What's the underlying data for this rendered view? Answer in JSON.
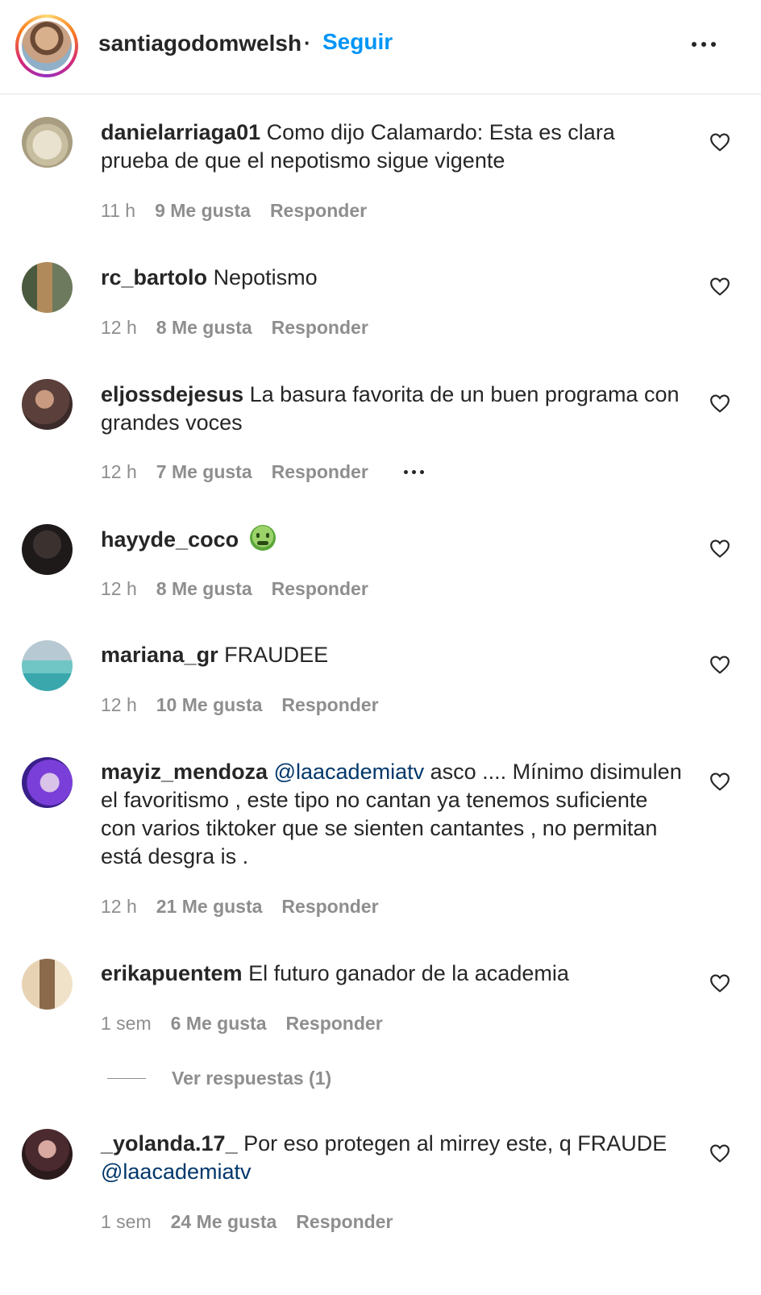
{
  "header": {
    "username": "santiagodomwelsh",
    "separator": "·",
    "follow_label": "Seguir"
  },
  "comments": [
    {
      "user": "danielarriaga01",
      "text": "Como dijo Calamardo: Esta es clara prueba de que el nepotismo sigue vigente",
      "time": "11 h",
      "likes": "9 Me gusta",
      "reply": "Responder"
    },
    {
      "user": "rc_bartolo",
      "text": "Nepotismo",
      "time": "12 h",
      "likes": "8 Me gusta",
      "reply": "Responder"
    },
    {
      "user": "eljossdejesus",
      "text": "La basura favorita de un buen programa con grandes voces",
      "time": "12 h",
      "likes": "7 Me gusta",
      "reply": "Responder"
    },
    {
      "user": "hayyde_coco",
      "text": "",
      "emoji": "nauseated-face-emoji",
      "time": "12 h",
      "likes": "8 Me gusta",
      "reply": "Responder"
    },
    {
      "user": "mariana_gr",
      "text": "FRAUDEE",
      "time": "12 h",
      "likes": "10 Me gusta",
      "reply": "Responder"
    },
    {
      "user": "mayiz_mendoza",
      "mention": "@laacademiatv",
      "text": "asco .... Mínimo disimulen el favoritismo , este tipo no cantan ya tenemos suficiente con varios tiktoker que se sienten cantantes , no permitan está desgra is .",
      "time": "12 h",
      "likes": "21 Me gusta",
      "reply": "Responder"
    },
    {
      "user": "erikapuentem",
      "text": "El futuro ganador de la academia",
      "time": "1 sem",
      "likes": "6 Me gusta",
      "reply": "Responder",
      "view_replies": "Ver respuestas (1)"
    },
    {
      "user": "_yolanda.17_",
      "text": "Por eso protegen al mirrey este, q FRAUDE",
      "mention": "@laacademiatv",
      "time": "1 sem",
      "likes": "24 Me gusta",
      "reply": "Responder"
    }
  ],
  "colors": {
    "accent": "#0095f6",
    "mention": "#00376b",
    "muted": "#8e8e8e",
    "text": "#262626"
  }
}
